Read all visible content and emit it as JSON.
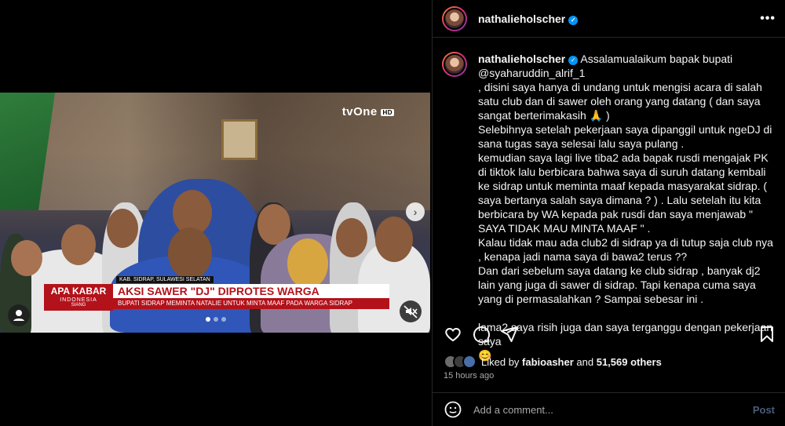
{
  "video": {
    "channel_logo": "tvOne",
    "channel_hd": "HD",
    "show_title": "APA KABAR",
    "show_sub": "INDONESIA",
    "show_sub2": "SIANG",
    "location": "KAB. SIDRAP, SULAWESI SELATAN",
    "headline": "AKSI SAWER \"DJ\" DIPROTES WARGA",
    "subheadline": "BUPATI SIDRAP MEMINTA NATALIE UNTUK MINTA MAAF PADA WARGA SIDRAP",
    "next_icon": "chevron-right-icon",
    "carousel_dots": 3,
    "carousel_active": 0
  },
  "header": {
    "username": "nathalieholscher",
    "verified_icon": "verified-badge-icon",
    "more_icon": "more-options-icon"
  },
  "caption": {
    "username": "nathalieholscher",
    "text": " Assalamualaikum bapak bupati\n@syaharuddin_alrif_1\n, disini saya hanya di undang untuk mengisi acara di salah satu club dan di sawer oleh orang yang datang ( dan saya sangat berterimakasih 🙏 )\nSelebihnya setelah pekerjaan saya dipanggil untuk ngeDJ di sana tugas saya selesai lalu saya pulang .\nkemudian saya lagi live tiba2 ada bapak rusdi mengajak PK di tiktok lalu berbicara bahwa saya di suruh datang kembali ke sidrap untuk meminta maaf kepada masyarakat sidrap. ( saya bertanya salah saya dimana ? ) . Lalu setelah itu kita berbicara by WA kepada pak rusdi dan saya menjawab \" SAYA TIDAK MAU MINTA MAAF \" .\nKalau tidak mau ada club2 di sidrap ya di tutup saja club nya , kenapa jadi nama saya di bawa2 terus ??\nDan dari sebelum saya datang ke club sidrap , banyak dj2 lain yang juga di sawer di sidrap. Tapi kenapa cuma saya yang di permasalahkan ? Sampai sebesar ini .\n\nlama2 saya risih juga dan saya terganggu dengan pekerjaan saya\n😊"
  },
  "actions": {
    "like_icon": "heart-icon",
    "comment_icon": "comment-icon",
    "share_icon": "share-icon",
    "save_icon": "bookmark-icon"
  },
  "likes": {
    "prefix": "Liked by ",
    "user": "fabioasher",
    "middle": " and ",
    "count": "51,569 others"
  },
  "timestamp": "15 hours ago",
  "comment": {
    "emoji_icon": "emoji-icon",
    "placeholder": "Add a comment...",
    "post_label": "Post"
  },
  "colors": {
    "background": "#000000",
    "border": "#262626",
    "verified": "#0095f6",
    "muted": "#a8a8a8",
    "post_disabled": "#4a5d7a",
    "news_red": "#b3121b"
  }
}
